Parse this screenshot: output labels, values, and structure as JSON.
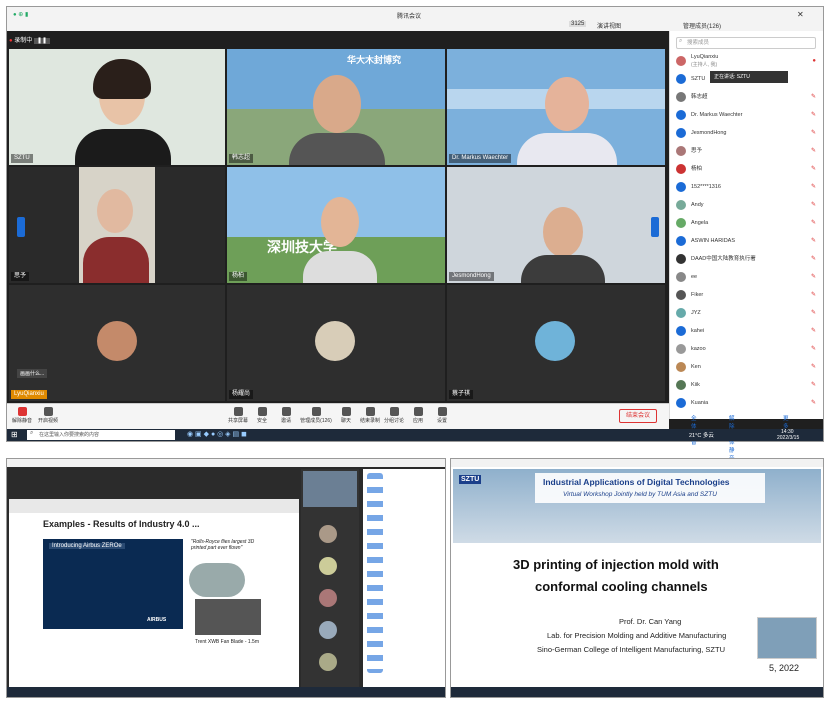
{
  "top": {
    "window_title": "腾讯会议",
    "recording_label": "录制中",
    "view_label": "演讲视图",
    "participants_label": "管理成员(126)",
    "resolution": "3125",
    "search_placeholder": "搜索成员",
    "tiles": [
      {
        "name": "SZTU"
      },
      {
        "name": "韩志超",
        "banner": "华大木封博究"
      },
      {
        "name": "Dr. Markus Waechter"
      },
      {
        "name": "思予"
      },
      {
        "name": "杨柏",
        "banner": "深圳技大学"
      },
      {
        "name": "JesmondHong"
      },
      {
        "name": "LyuQianxiu"
      },
      {
        "name": "杨耀尚"
      },
      {
        "name": "蔡子祺"
      }
    ],
    "tile_left_label": "画画什么...",
    "speaking_label": "正在讲话: SZTU",
    "participants": [
      {
        "name": "LyuQianxiu",
        "sub": "(主持人, 我)"
      },
      {
        "name": "SZTU"
      },
      {
        "name": "韩志超"
      },
      {
        "name": "Dr. Markus Waechter"
      },
      {
        "name": "JesmondHong"
      },
      {
        "name": "思予"
      },
      {
        "name": "杨柏"
      },
      {
        "name": "152****1316"
      },
      {
        "name": "Andy"
      },
      {
        "name": "Angela"
      },
      {
        "name": "ASWIN HARIDAS"
      },
      {
        "name": "DAAD中国大陆教育执行署"
      },
      {
        "name": "ee"
      },
      {
        "name": "Fiker"
      },
      {
        "name": "JYZ"
      },
      {
        "name": "kahei"
      },
      {
        "name": "kazoo"
      },
      {
        "name": "Ken"
      },
      {
        "name": "Kiik"
      },
      {
        "name": "Kuania"
      }
    ],
    "panel_buttons": [
      "全体静音",
      "解除全体静音",
      "更多"
    ],
    "controls": [
      "解除静音",
      "开启视频",
      "共享屏幕",
      "安全",
      "邀请",
      "管理成员(126)",
      "聊天",
      "结束录制",
      "分组讨论",
      "应用",
      "设置"
    ],
    "leave_label": "结束会议",
    "taskbar": {
      "search": "在这里输入你要搜索的内容",
      "temp": "21°C 多云",
      "time": "14:30",
      "date": "2022/3/15"
    }
  },
  "bottom_left": {
    "slide_title": "Examples - Results of Industry 4.0 ...",
    "airbus_label": "Introducing Airbus ZEROe",
    "quote": "\"Rolls-Royce flies largest 3D printed part ever flown\"",
    "engine_caption": "Trent XWB Fan Blade - 1.5m",
    "brand": "AIRBUS"
  },
  "bottom_right": {
    "header_title": "Industrial Applications of Digital Technologies",
    "header_sub": "Virtual Workshop Jointly held by TUM Asia and SZTU",
    "logo": "SZTU",
    "title_line1": "3D printing of injection mold with",
    "title_line2": "conformal cooling channels",
    "author": "Prof. Dr. Can Yang",
    "lab": "Lab. for Precision Molding and Additive Manufacturing",
    "college": "Sino-German College of Intelligent Manufacturing, SZTU",
    "date_fragment": "5, 2022"
  }
}
